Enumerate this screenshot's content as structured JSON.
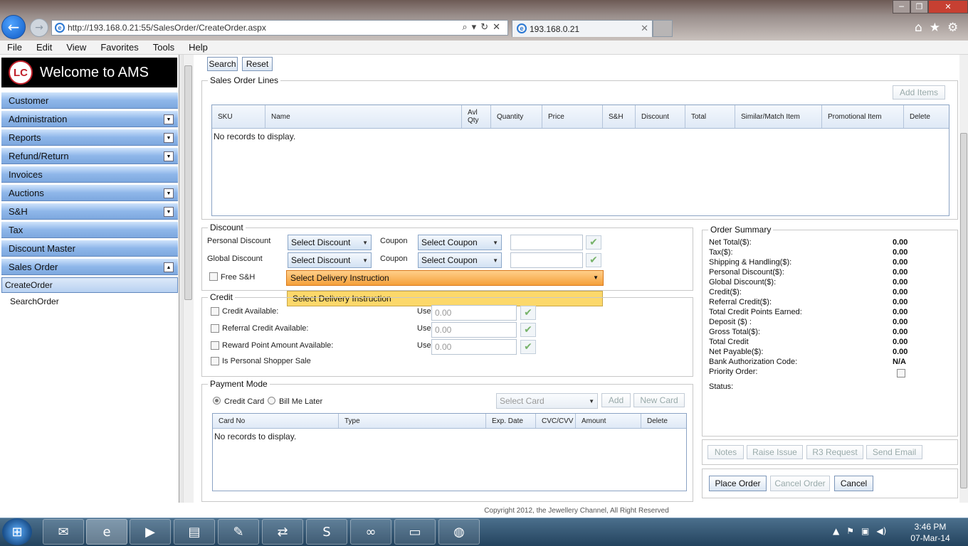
{
  "browser": {
    "url": "http://193.168.0.21:55/SalesOrder/CreateOrder.aspx",
    "tab_title": "193.168.0.21",
    "menu": [
      "File",
      "Edit",
      "View",
      "Favorites",
      "Tools",
      "Help"
    ]
  },
  "sidebar": {
    "brand": "Welcome to AMS",
    "logo_text": "LC",
    "items": [
      {
        "label": "Customer",
        "dropdown": false
      },
      {
        "label": "Administration",
        "dropdown": true
      },
      {
        "label": "Reports",
        "dropdown": true
      },
      {
        "label": "Refund/Return",
        "dropdown": true
      },
      {
        "label": "Invoices",
        "dropdown": false
      },
      {
        "label": "Auctions",
        "dropdown": true
      },
      {
        "label": "S&H",
        "dropdown": true
      },
      {
        "label": "Tax",
        "dropdown": false
      },
      {
        "label": "Discount Master",
        "dropdown": false
      },
      {
        "label": "Sales Order",
        "dropdown": true
      }
    ],
    "subitems": [
      "CreateOrder",
      "SearchOrder"
    ]
  },
  "toolbar": {
    "search": "Search",
    "reset": "Reset"
  },
  "order_lines": {
    "legend": "Sales Order Lines",
    "add_items": "Add Items",
    "columns": [
      "SKU",
      "Name",
      "Avl Qty",
      "Quantity",
      "Price",
      "S&H",
      "Discount",
      "Total",
      "Similar/Match Item",
      "Promotional Item",
      "Delete"
    ],
    "empty": "No records to display."
  },
  "discount": {
    "legend": "Discount",
    "personal_label": "Personal Discount",
    "global_label": "Global Discount",
    "coupon_label": "Coupon",
    "select_discount": "Select Discount",
    "select_coupon": "Select Coupon",
    "free_sh": "Free S&H",
    "delivery_value": "Select Delivery Instruction",
    "delivery_option": "Select Delivery Instruction"
  },
  "credit": {
    "legend": "Credit",
    "use_label": "Use",
    "rows": [
      {
        "label": "Credit Available:",
        "value": "0.00"
      },
      {
        "label": "Referral Credit Available:",
        "value": "0.00"
      },
      {
        "label": "Reward Point Amount Available:",
        "value": "0.00"
      }
    ],
    "personal_shopper": "Is Personal Shopper Sale"
  },
  "payment": {
    "legend": "Payment Mode",
    "credit_card": "Credit Card",
    "bill_me_later": "Bill Me Later",
    "select_card": "Select Card",
    "add": "Add",
    "new_card": "New Card",
    "columns": [
      "Card No",
      "Type",
      "Exp. Date",
      "CVC/CVV",
      "Amount",
      "Delete"
    ],
    "empty": "No records to display."
  },
  "summary": {
    "legend": "Order Summary",
    "rows": [
      {
        "label": "Net Total($):",
        "value": "0.00"
      },
      {
        "label": "Tax($):",
        "value": "0.00"
      },
      {
        "label": "Shipping & Handling($):",
        "value": "0.00"
      },
      {
        "label": "Personal Discount($):",
        "value": "0.00"
      },
      {
        "label": "Global Discount($):",
        "value": "0.00"
      },
      {
        "label": "Credit($):",
        "value": "0.00"
      },
      {
        "label": "Referral Credit($):",
        "value": "0.00"
      },
      {
        "label": "Total Credit Points Earned:",
        "value": "0.00"
      },
      {
        "label": "Deposit ($) :",
        "value": "0.00"
      },
      {
        "label": "Gross Total($):",
        "value": "0.00"
      },
      {
        "label": "Total Credit",
        "value": "0.00"
      },
      {
        "label": "Net Payable($):",
        "value": "0.00"
      },
      {
        "label": "Bank Authorization Code:",
        "value": "N/A"
      }
    ],
    "priority": "Priority Order:",
    "status": "Status:"
  },
  "actions": {
    "notes": "Notes",
    "raise_issue": "Raise Issue",
    "r3_request": "R3 Request",
    "send_email": "Send Email",
    "place_order": "Place Order",
    "cancel_order": "Cancel Order",
    "cancel": "Cancel"
  },
  "footer": "Copyright 2012, the Jewellery Channel, All Right Reserved",
  "taskbar": {
    "time": "3:46 PM",
    "date": "07-Mar-14"
  }
}
